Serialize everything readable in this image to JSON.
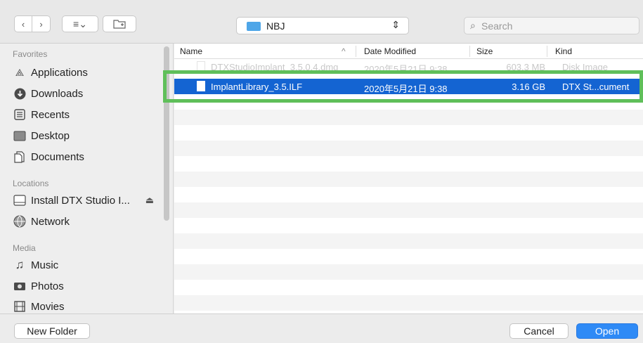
{
  "toolbar": {
    "back_icon": "chevron-left",
    "forward_icon": "chevron-right",
    "view_icon": "list-view",
    "new_folder_icon": "new-folder",
    "path_label": "NBJ",
    "search_placeholder": "Search"
  },
  "sidebar": {
    "favorites_heading": "Favorites",
    "favorites": [
      {
        "label": "Applications",
        "icon": "applications-icon"
      },
      {
        "label": "Downloads",
        "icon": "downloads-icon"
      },
      {
        "label": "Recents",
        "icon": "recents-icon"
      },
      {
        "label": "Desktop",
        "icon": "desktop-icon"
      },
      {
        "label": "Documents",
        "icon": "documents-icon"
      }
    ],
    "locations_heading": "Locations",
    "locations": [
      {
        "label": "Install DTX Studio I...",
        "icon": "disk-icon"
      },
      {
        "label": "Network",
        "icon": "network-icon"
      }
    ],
    "media_heading": "Media",
    "media": [
      {
        "label": "Music",
        "icon": "music-icon"
      },
      {
        "label": "Photos",
        "icon": "photos-icon"
      },
      {
        "label": "Movies",
        "icon": "movies-icon"
      }
    ]
  },
  "columns": {
    "name": "Name",
    "date": "Date Modified",
    "size": "Size",
    "kind": "Kind",
    "sort_indicator": "^"
  },
  "files": [
    {
      "name": "DTXStudioImplant_3.5.0.4.dmg",
      "date": "2020年5月21日 9:38",
      "size": "603.3 MB",
      "kind": "Disk Image",
      "state": "faded"
    },
    {
      "name": "ImplantLibrary_3.5.ILF",
      "date": "2020年5月21日 9:38",
      "size": "3.16 GB",
      "kind": "DTX St...cument",
      "state": "selected"
    }
  ],
  "buttons": {
    "new_folder": "New Folder",
    "cancel": "Cancel",
    "open": "Open"
  },
  "colors": {
    "selection": "#1464d2",
    "highlight": "#5fbf5a",
    "open_button": "#2e8af6"
  }
}
